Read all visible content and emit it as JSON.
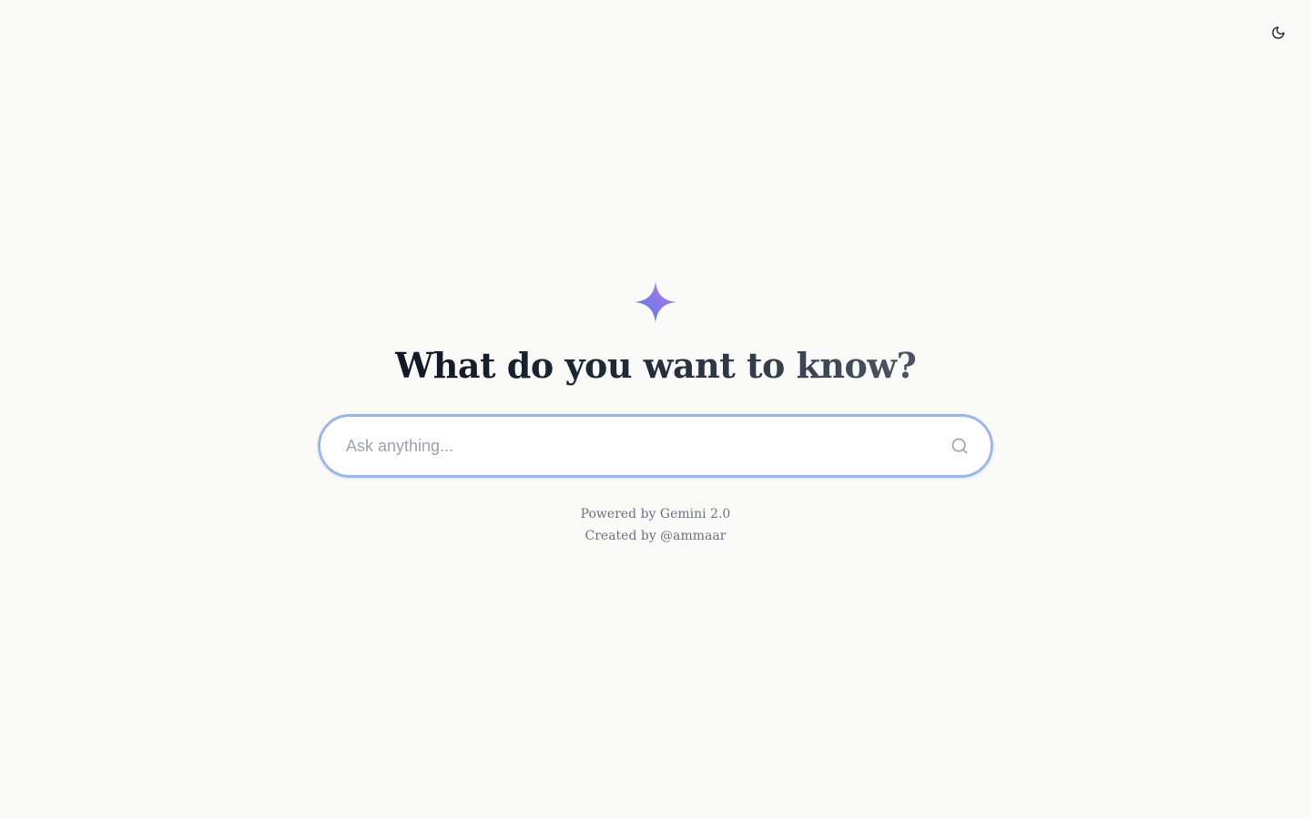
{
  "header": {
    "theme_toggle_icon": "moon-icon"
  },
  "hero": {
    "logo_icon": "sparkle-icon",
    "headline": "What do you want to know?"
  },
  "search": {
    "placeholder": "Ask anything...",
    "value": "",
    "submit_icon": "search-icon"
  },
  "footer": {
    "powered_by": "Powered by Gemini 2.0",
    "created_by": "Created by @ammaar"
  },
  "colors": {
    "background": "#fafaf9",
    "search_border": "#9bb8ea",
    "sparkle_start": "#4f7df0",
    "sparkle_end": "#b07ad6",
    "footer_text": "#6b7280"
  }
}
